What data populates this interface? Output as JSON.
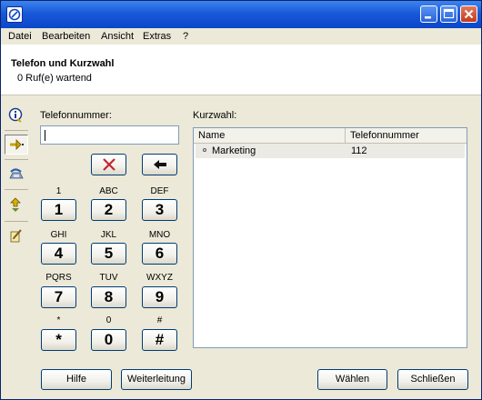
{
  "menubar": {
    "items": [
      "Datei",
      "Bearbeiten",
      "Ansicht",
      "Extras",
      "?"
    ]
  },
  "header": {
    "title": "Telefon und Kurzwahl",
    "status": "0 Ruf(e) wartend"
  },
  "sidebar": {
    "icons": [
      "info-icon",
      "dial-arrow-icon",
      "phone-handset-icon",
      "transfer-arrows-icon",
      "notepad-pen-icon"
    ],
    "active_index": 1
  },
  "dialer": {
    "label": "Telefonnummer:",
    "input_value": "",
    "keys": [
      {
        "digit": "1",
        "letters": "1"
      },
      {
        "digit": "2",
        "letters": "ABC"
      },
      {
        "digit": "3",
        "letters": "DEF"
      },
      {
        "digit": "4",
        "letters": "GHI"
      },
      {
        "digit": "5",
        "letters": "JKL"
      },
      {
        "digit": "6",
        "letters": "MNO"
      },
      {
        "digit": "7",
        "letters": "PQRS"
      },
      {
        "digit": "8",
        "letters": "TUV"
      },
      {
        "digit": "9",
        "letters": "WXYZ"
      },
      {
        "digit": "*",
        "letters": "*"
      },
      {
        "digit": "0",
        "letters": "0"
      },
      {
        "digit": "#",
        "letters": "#"
      }
    ]
  },
  "speed_dial": {
    "label": "Kurzwahl:",
    "columns": [
      "Name",
      "Telefonnummer"
    ],
    "rows": [
      {
        "name": "Marketing",
        "number": "112"
      }
    ]
  },
  "buttons": {
    "help": "Hilfe",
    "forward": "Weiterleitung",
    "dial": "Wählen",
    "close": "Schließen"
  },
  "colors": {
    "titlebar": "#1859d9",
    "window_bg": "#ece9d8",
    "clear_x": "#c1272d",
    "button_border": "#003c74"
  }
}
